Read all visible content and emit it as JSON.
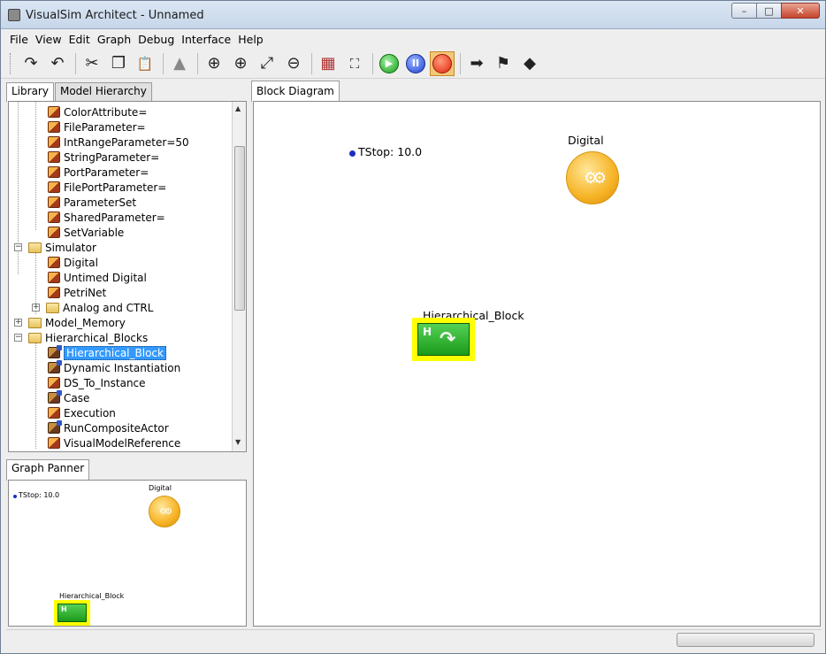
{
  "window": {
    "title": "VisualSim Architect - Unnamed",
    "minimize": "–",
    "maximize": "□",
    "close": "✕"
  },
  "menu": [
    "File",
    "View",
    "Edit",
    "Graph",
    "Debug",
    "Interface",
    "Help"
  ],
  "toolbar": {
    "icons": [
      "redo-icon",
      "undo-icon",
      "cut-icon",
      "copy-icon",
      "paste-icon",
      "up-triangle-icon",
      "zoom-in-icon",
      "zoom-reset-icon",
      "zoom-fit-icon",
      "zoom-out-icon",
      "grid-icon",
      "fullscreen-icon",
      "run-icon",
      "pause-icon",
      "stop-icon",
      "arrow-icon",
      "flag-icon",
      "diamond-icon"
    ],
    "glyphs": {
      "redo": "↷",
      "undo": "↶",
      "cut": "✂",
      "copy": "❐",
      "paste": "📋",
      "triangle": "▲",
      "zoom_in": "⊕",
      "zoom_reset": "⊕",
      "zoom_fit": "⤢",
      "zoom_out": "⊖",
      "grid": "▦",
      "fullscreen": "⛶",
      "pause": "II",
      "arrow": "➡",
      "flag": "⚑",
      "diamond": "◆"
    }
  },
  "library": {
    "tabs": [
      "Library",
      "Model Hierarchy"
    ],
    "tree": [
      {
        "label": "ColorAttribute=",
        "type": "actor"
      },
      {
        "label": "FileParameter=",
        "type": "actor"
      },
      {
        "label": "IntRangeParameter=50",
        "type": "actor"
      },
      {
        "label": "StringParameter=",
        "type": "actor"
      },
      {
        "label": "PortParameter=",
        "type": "actor"
      },
      {
        "label": "FilePortParameter=",
        "type": "actor"
      },
      {
        "label": "ParameterSet",
        "type": "actor"
      },
      {
        "label": "SharedParameter=",
        "type": "actor"
      },
      {
        "label": "SetVariable",
        "type": "actor"
      },
      {
        "label": "Simulator",
        "type": "folder"
      },
      {
        "label": "Digital",
        "type": "actor"
      },
      {
        "label": "Untimed Digital",
        "type": "actor"
      },
      {
        "label": "PetriNet",
        "type": "actor"
      },
      {
        "label": "Analog and CTRL",
        "type": "folder"
      },
      {
        "label": "Model_Memory",
        "type": "folder"
      },
      {
        "label": "Hierarchical_Blocks",
        "type": "folder"
      },
      {
        "label": "Hierarchical_Block",
        "type": "composite"
      },
      {
        "label": "Dynamic Instantiation",
        "type": "composite"
      },
      {
        "label": "DS_To_Instance",
        "type": "actor"
      },
      {
        "label": "Case",
        "type": "composite"
      },
      {
        "label": "Execution",
        "type": "actor"
      },
      {
        "label": "RunCompositeActor",
        "type": "composite"
      },
      {
        "label": "VisualModelReference",
        "type": "actor"
      }
    ],
    "expander_plus": "+",
    "expander_minus": "−"
  },
  "panner": {
    "tab": "Graph Panner",
    "tstop": "TStop: 10.0",
    "digital": "Digital",
    "hblock": "Hierarchical_Block",
    "hletter": "H"
  },
  "diagram": {
    "tab": "Block Diagram",
    "tstop": "TStop: 10.0",
    "digital": "Digital",
    "hblock": "Hierarchical_Block",
    "hletter": "H",
    "gear_glyph": "⚙⚙",
    "arrow_glyph": "↷"
  },
  "colors": {
    "selection": "#3399ff",
    "hblock_highlight": "#ffff00",
    "director": "#1a2fbf"
  }
}
